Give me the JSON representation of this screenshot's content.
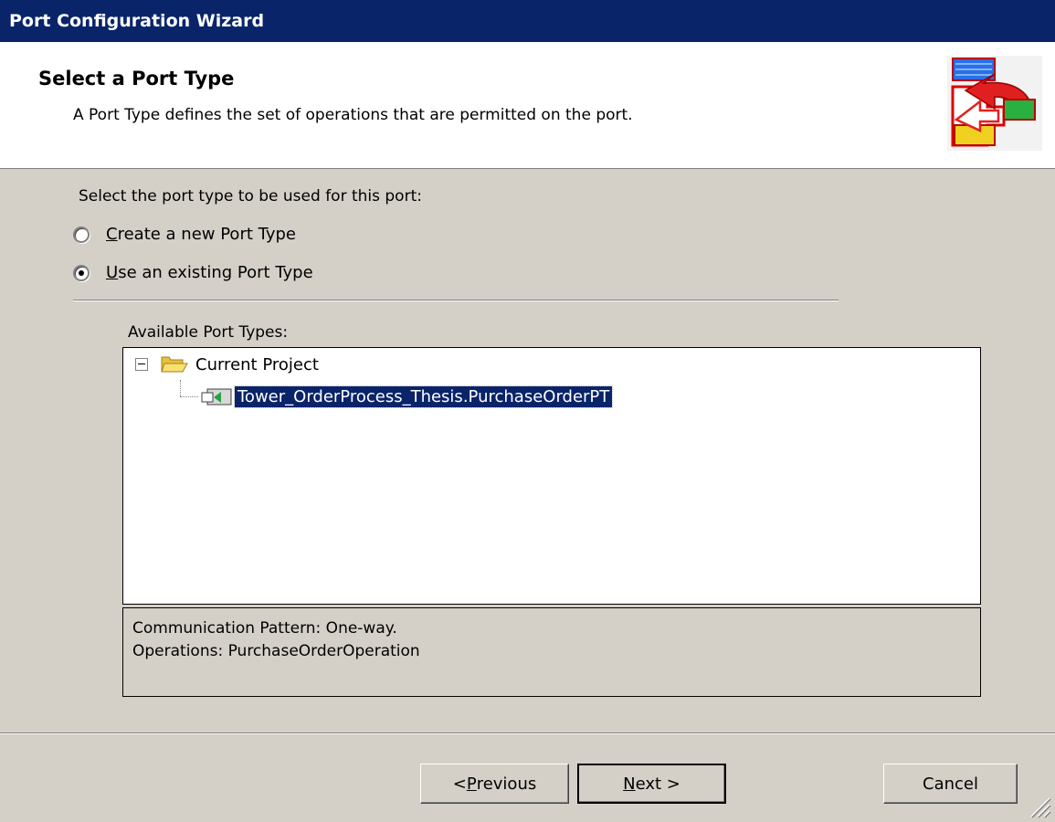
{
  "window": {
    "title": "Port Configuration Wizard"
  },
  "header": {
    "title": "Select a Port Type",
    "description": "A Port Type defines the set of operations that are permitted on the port.",
    "icon": "wizard-port-icon"
  },
  "prompt": "Select the port type to be used for this port:",
  "options": [
    {
      "mnemonic": "C",
      "rest": "reate a new Port Type",
      "checked": false
    },
    {
      "mnemonic": "U",
      "rest": "se an existing Port Type",
      "checked": true
    }
  ],
  "available_label": "Available Port Types:",
  "tree": {
    "root": {
      "label": "Current Project",
      "expanded": true,
      "icon": "folder-open-icon"
    },
    "children": [
      {
        "label": "Tower_OrderProcess_Thesis.PurchaseOrderPT",
        "selected": true,
        "icon": "port-type-icon"
      }
    ]
  },
  "details": {
    "line1": "Communication Pattern: One-way.",
    "line2": "Operations: PurchaseOrderOperation"
  },
  "buttons": {
    "previous": {
      "pre": "< ",
      "mnemonic": "P",
      "rest": "revious"
    },
    "next": {
      "mnemonic": "N",
      "rest": "ext >"
    },
    "cancel": "Cancel"
  },
  "colors": {
    "title_bar": "#0a246a",
    "dialog_bg": "#d4d0c8",
    "selection": "#0a246a"
  }
}
